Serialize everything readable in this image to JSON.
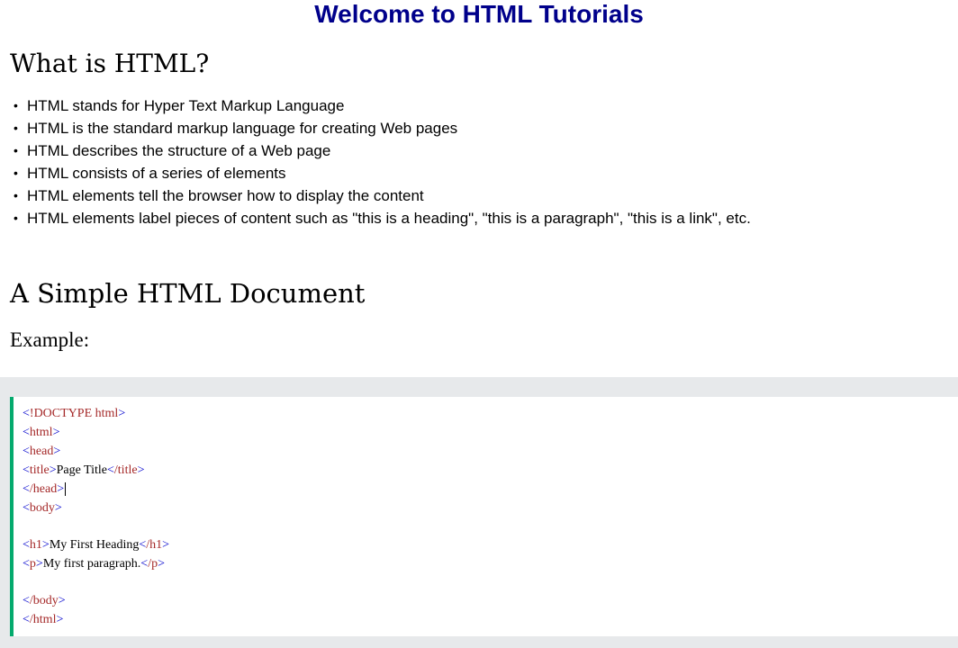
{
  "page": {
    "title": "Welcome to HTML Tutorials"
  },
  "section1": {
    "heading": "What is HTML?",
    "items": [
      "HTML stands for Hyper Text Markup Language",
      "HTML is the standard markup language for creating Web pages",
      "HTML describes the structure of a Web page",
      "HTML consists of a series of elements",
      "HTML elements tell the browser how to display the content",
      "HTML elements label pieces of content such as \"this is a heading\", \"this is a paragraph\", \"this is a link\", etc."
    ]
  },
  "section2": {
    "heading": "A Simple HTML Document",
    "example_label": "Example:"
  },
  "code": {
    "doctype": "!DOCTYPE",
    "doctype_name": " html",
    "html_open": "html",
    "head_open": "head",
    "title_open": "title",
    "title_text": "Page Title",
    "title_close": "/title",
    "head_close": "/head",
    "body_open": "body",
    "h1_open": "h1",
    "h1_text": "My First Heading",
    "h1_close": "/h1",
    "p_open": "p",
    "p_text": "My first paragraph.",
    "p_close": "/p",
    "body_close": "/body",
    "html_close": "/html"
  },
  "colors": {
    "title": "#00008b",
    "accent_border": "#04aa6d",
    "code_tag": "#a52a2a",
    "code_bracket": "#0000cd",
    "code_bg_outer": "#e7e9eb"
  }
}
